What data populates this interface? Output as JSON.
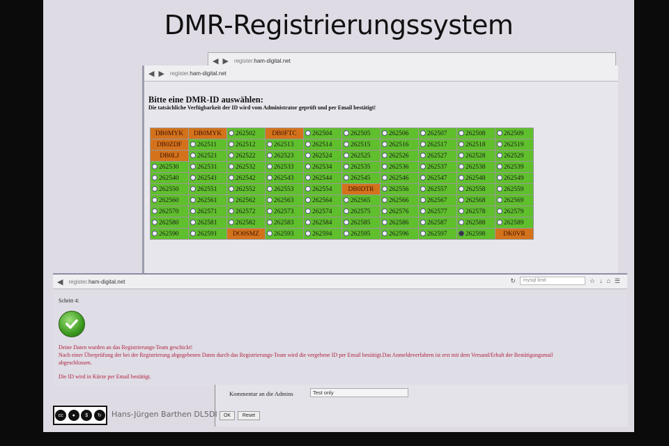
{
  "slide": {
    "title": "DMR-Registrierungssystem",
    "author": "Hans-Jürgen Barthen DL5DI"
  },
  "back_window": {
    "url_grey": "register.",
    "url_domain": "ham-digital.net"
  },
  "main_window": {
    "url_grey": "register.",
    "url_domain": "ham-digital.net",
    "heading": "Bitte eine DMR-ID auswählen:",
    "subheading": "Die tatsächliche Verfügbarkeit der ID wird vom Administrator geprüft und per Email bestätigt!",
    "grid": [
      [
        "DB0MYK",
        "DB0MYK",
        "262502",
        "DB0FTC",
        "262504",
        "262505",
        "262506",
        "262507",
        "262508",
        "262509"
      ],
      [
        "DB0ZDF",
        "262511",
        "262512",
        "262513",
        "262514",
        "262515",
        "262516",
        "262517",
        "262518",
        "262519"
      ],
      [
        "DB0LJ",
        "262521",
        "262522",
        "262523",
        "262524",
        "262525",
        "262526",
        "262527",
        "262528",
        "262529"
      ],
      [
        "262530",
        "262531",
        "262532",
        "262533",
        "262534",
        "262535",
        "262536",
        "262537",
        "262538",
        "262539"
      ],
      [
        "262540",
        "262541",
        "262542",
        "262543",
        "262544",
        "262545",
        "262546",
        "262547",
        "262548",
        "262549"
      ],
      [
        "262550",
        "262551",
        "262552",
        "262553",
        "262554",
        "DB0DTR",
        "262556",
        "262557",
        "262558",
        "262559"
      ],
      [
        "262560",
        "262561",
        "262562",
        "262563",
        "262564",
        "262565",
        "262566",
        "262567",
        "262568",
        "262569"
      ],
      [
        "262570",
        "262571",
        "262572",
        "262573",
        "262574",
        "262575",
        "262576",
        "262577",
        "262578",
        "262579"
      ],
      [
        "262580",
        "262581",
        "262582",
        "262583",
        "262584",
        "262585",
        "262586",
        "262587",
        "262588",
        "262589"
      ],
      [
        "262590",
        "262591",
        "DO0SMZ",
        "262593",
        "262594",
        "262595",
        "262596",
        "262597",
        "262598",
        "DK0VR"
      ]
    ],
    "selected_id": "262598",
    "colors": {
      "free": "#5fbf2c",
      "taken": "#d4721c"
    }
  },
  "bottom_window": {
    "url_grey": "register.",
    "url_domain": "ham-digital.net",
    "search_placeholder": "mysql limit",
    "step": "Schritt 4:",
    "message_line1": "Deine Daten wurden an das Registrierungs-Team geschickt!",
    "message_line2": "Nach einer Überprüfung der bei der Registrierung abgegebenen Daten durch das Registrierungs-Team wird die vergebene ID per Email bestätigt.Das Anmeldeverfahren ist erst mit dem Versand/Erhalt der Bestätigungsmail",
    "message_line3": "abgeschlossen.",
    "message_line4": "Die ID wird in Kürze per Email bestätigt.",
    "message_color": "#b0223c"
  },
  "form_window": {
    "comment_label": "Kommentar an die Admins",
    "comment_value": "Test only",
    "ok_label": "OK",
    "reset_label": "Reset"
  }
}
